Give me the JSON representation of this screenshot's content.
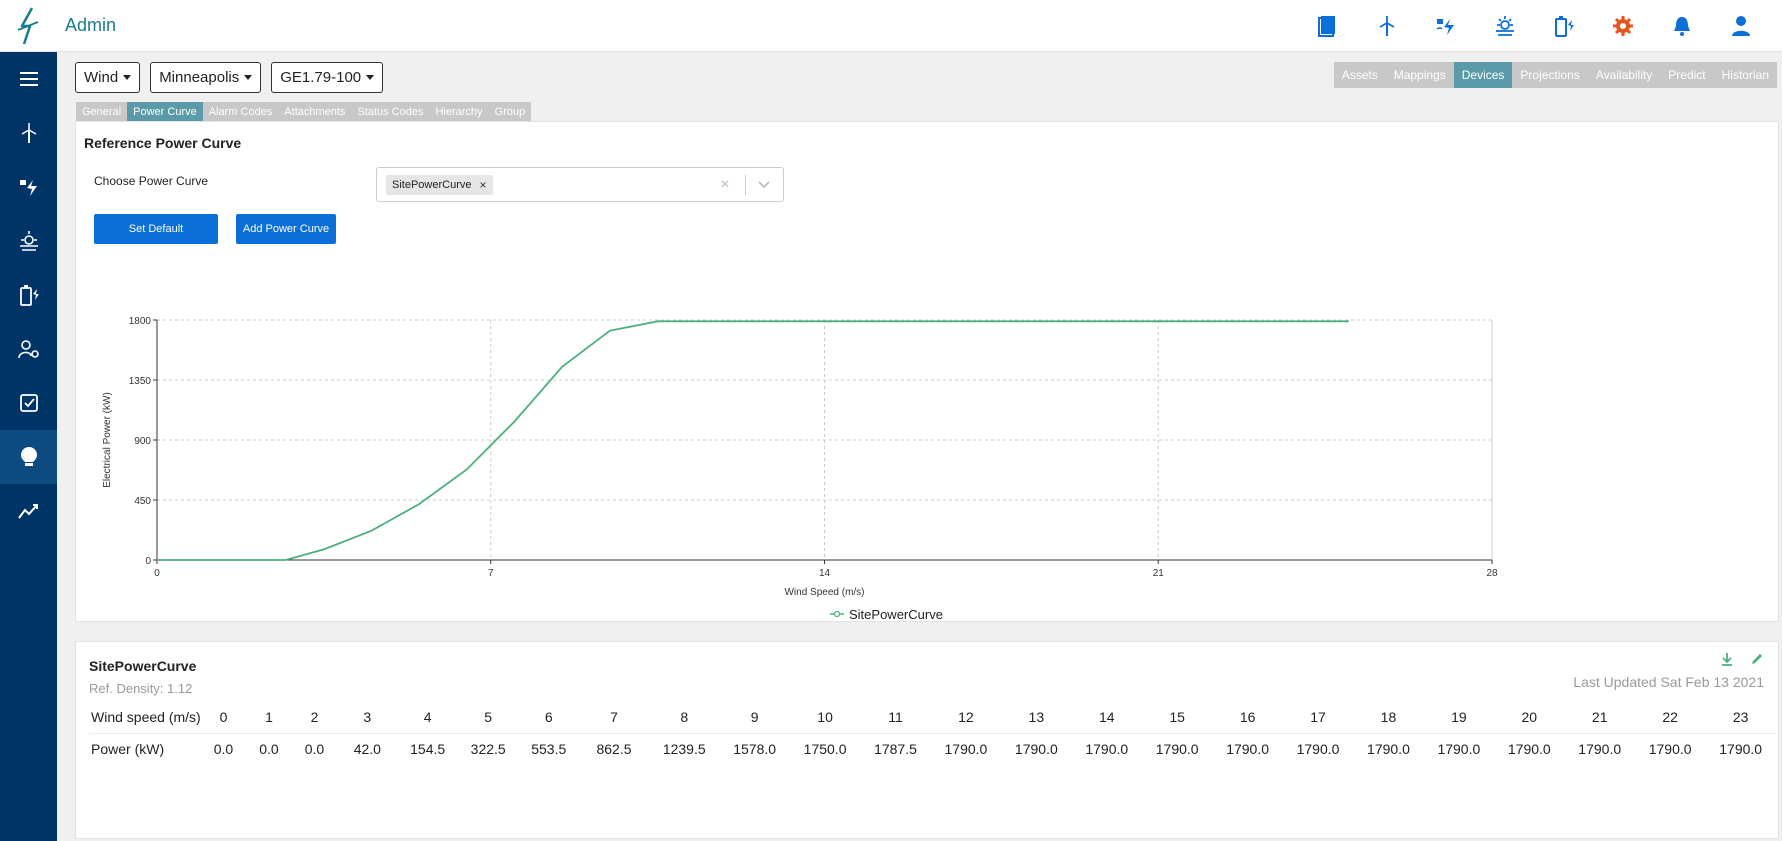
{
  "app": {
    "title": "Admin"
  },
  "header_icons": [
    "book-icon",
    "wind-turbine-icon",
    "hydro-icon",
    "solar-icon",
    "battery-icon",
    "settings-gear-icon",
    "bell-icon",
    "user-icon"
  ],
  "sidebar_icons": [
    "menu-icon",
    "wind-turbine-icon",
    "hydro-icon",
    "solar-icon",
    "battery-icon",
    "user-settings-icon",
    "checkbox-icon",
    "lightbulb-icon",
    "analytics-icon"
  ],
  "selectors": {
    "asset_type": "Wind",
    "site": "Minneapolis",
    "model": "GE1.79-100"
  },
  "nav_tabs": [
    {
      "label": "Assets",
      "active": false
    },
    {
      "label": "Mappings",
      "active": false
    },
    {
      "label": "Devices",
      "active": true
    },
    {
      "label": "Projections",
      "active": false
    },
    {
      "label": "Availability",
      "active": false
    },
    {
      "label": "Predict",
      "active": false
    },
    {
      "label": "Historian",
      "active": false
    }
  ],
  "sub_tabs": [
    {
      "label": "General",
      "active": false
    },
    {
      "label": "Power Curve",
      "active": true
    },
    {
      "label": "Alarm Codes",
      "active": false
    },
    {
      "label": "Attachments",
      "active": false
    },
    {
      "label": "Status Codes",
      "active": false
    },
    {
      "label": "Hierarchy",
      "active": false
    },
    {
      "label": "Group",
      "active": false
    }
  ],
  "reference": {
    "title": "Reference Power Curve",
    "choose_label": "Choose Power Curve",
    "selected_curve": "SitePowerCurve",
    "set_default_label": "Set Default",
    "add_curve_label": "Add Power Curve"
  },
  "chart_data": {
    "type": "line",
    "xlabel": "Wind Speed (m/s)",
    "ylabel": "Electrical Power (kW)",
    "xlim": [
      0,
      28
    ],
    "ylim": [
      0,
      1800
    ],
    "x_ticks": [
      0,
      7,
      14,
      21,
      28
    ],
    "y_ticks": [
      0,
      450,
      900,
      1350,
      1800
    ],
    "grid": true,
    "legend": "bottom-center",
    "series": [
      {
        "name": "SitePowerCurve",
        "color": "#4caf7d",
        "x": [
          0,
          1,
          2,
          2.7,
          3.5,
          4.5,
          5.5,
          6.5,
          7.5,
          8.5,
          9.5,
          10.5,
          11.5,
          12,
          13,
          14,
          15,
          16,
          17,
          18,
          19,
          20,
          21,
          22,
          23,
          24,
          25
        ],
        "y": [
          0,
          0,
          0,
          0,
          80,
          220,
          420,
          680,
          1040,
          1450,
          1720,
          1790,
          1790,
          1790,
          1790,
          1790,
          1790,
          1790,
          1790,
          1790,
          1790,
          1790,
          1790,
          1790,
          1790,
          1790,
          1790
        ]
      }
    ]
  },
  "table": {
    "title": "SitePowerCurve",
    "subtitle": "Ref. Density: 1.12",
    "last_updated": "Last Updated Sat Feb 13 2021",
    "row_labels": {
      "speed": "Wind speed (m/s)",
      "power": "Power (kW)"
    },
    "speeds": [
      "0",
      "1",
      "2",
      "3",
      "4",
      "5",
      "6",
      "7",
      "8",
      "9",
      "10",
      "11",
      "12",
      "13",
      "14",
      "15",
      "16",
      "17",
      "18",
      "19",
      "20",
      "21",
      "22",
      "23"
    ],
    "powers": [
      "0.0",
      "0.0",
      "0.0",
      "42.0",
      "154.5",
      "322.5",
      "553.5",
      "862.5",
      "1239.5",
      "1578.0",
      "1750.0",
      "1787.5",
      "1790.0",
      "1790.0",
      "1790.0",
      "1790.0",
      "1790.0",
      "1790.0",
      "1790.0",
      "1790.0",
      "1790.0",
      "1790.0",
      "1790.0",
      "1790.0"
    ]
  },
  "colors": {
    "primary": "#0a6fd8",
    "teal": "#1a7c8c",
    "sidebar": "#003366",
    "curve": "#4caf7d",
    "accent_orange": "#e8541e"
  }
}
